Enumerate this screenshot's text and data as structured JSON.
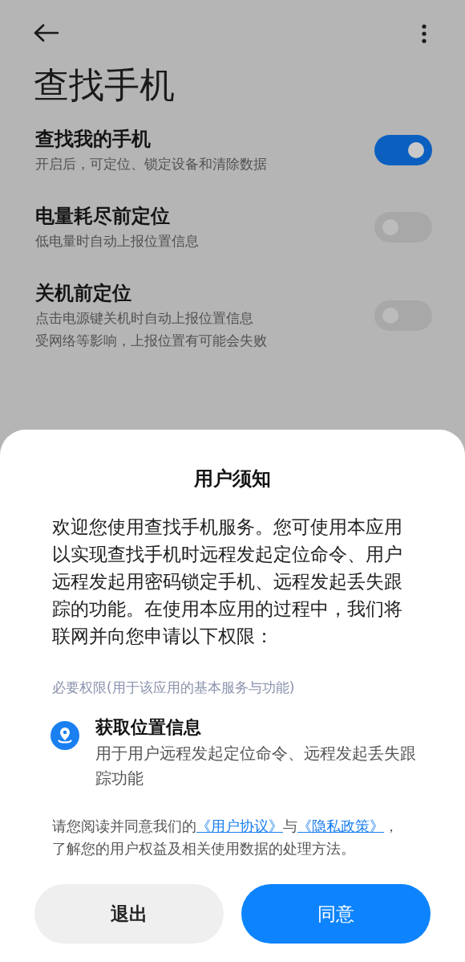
{
  "page": {
    "title": "查找手机"
  },
  "settings": [
    {
      "title": "查找我的手机",
      "description": [
        "开启后，可定位、锁定设备和清除数据"
      ],
      "on": true
    },
    {
      "title": "电量耗尽前定位",
      "description": [
        "低电量时自动上报位置信息"
      ],
      "on": false
    },
    {
      "title": "关机前定位",
      "description": [
        "点击电源键关机时自动上报位置信息",
        "受网络等影响，上报位置有可能会失败"
      ],
      "on": false
    }
  ],
  "dialog": {
    "title": "用户须知",
    "intro": "欢迎您使用查找手机服务。您可使用本应用以实现查找手机时远程发起定位命令、用户远程发起用密码锁定手机、远程发起丢失跟踪的功能。在使用本应用的过程中，我们将联网并向您申请以下权限：",
    "section_label": "必要权限(用于该应用的基本服务与功能)",
    "permissions": [
      {
        "title": "获取位置信息",
        "description": "用于用户远程发起定位命令、远程发起丢失跟踪功能"
      }
    ],
    "consent": [
      {
        "kind": "text",
        "text": "请您阅读并同意我们的"
      },
      {
        "kind": "link",
        "text": "《用户协议》"
      },
      {
        "kind": "text",
        "text": "与"
      },
      {
        "kind": "link",
        "text": "《隐私政策》"
      },
      {
        "kind": "text",
        "text": "，了解您的用户权益及相关使用数据的处理方法。"
      }
    ],
    "buttons": [
      {
        "label": "退出",
        "kind": "secondary"
      },
      {
        "label": "同意",
        "kind": "primary"
      }
    ]
  }
}
